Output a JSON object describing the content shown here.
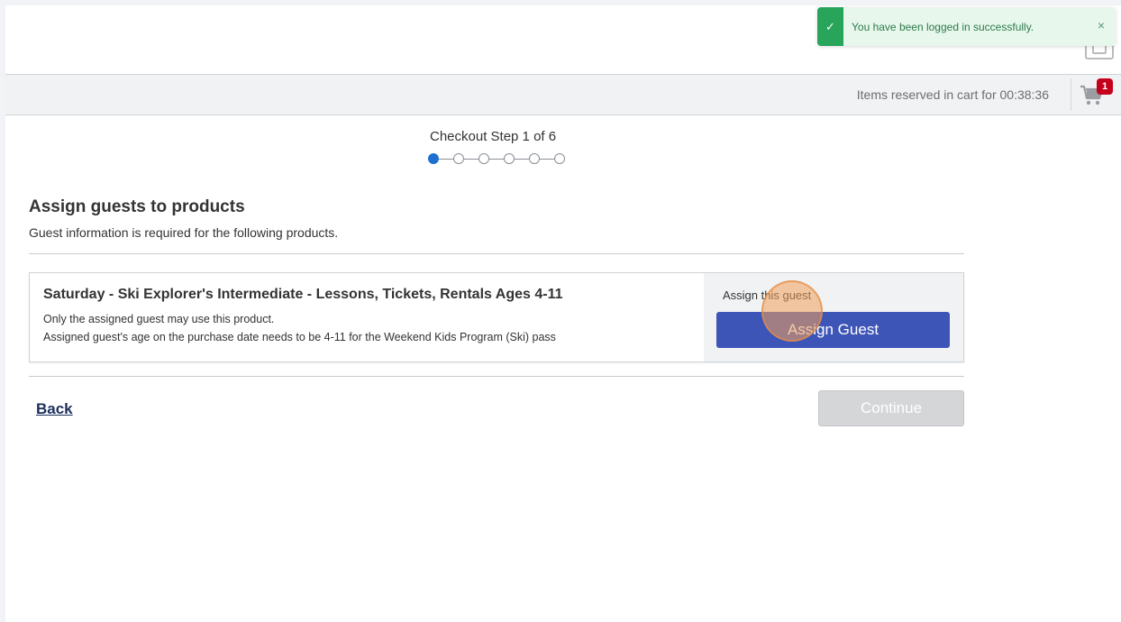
{
  "toast": {
    "message": "You have been logged in successfully.",
    "check_glyph": "✓",
    "close_glyph": "×",
    "accent_color": "#28a55a"
  },
  "cart": {
    "reservation_text": "Items reserved in cart for 00:38:36",
    "count": "1"
  },
  "stepper": {
    "label": "Checkout Step 1 of 6",
    "current_step": 1,
    "total_steps": 6
  },
  "section": {
    "title": "Assign guests to products",
    "subtitle": "Guest information is required for the following products."
  },
  "product": {
    "title": "Saturday - Ski Explorer's Intermediate - Lessons, Tickets, Rentals Ages 4-11",
    "note_1": "Only the assigned guest may use this product.",
    "note_2": "Assigned guest's age on the purchase date needs to be 4-11 for the Weekend Kids Program (Ski) pass",
    "assign_label": "Assign this guest",
    "assign_button": "Assign Guest"
  },
  "nav": {
    "back_label": "Back",
    "continue_label": "Continue"
  },
  "colors": {
    "primary_button": "#3e55b8",
    "active_step": "#1f6fd1",
    "cart_badge": "#c4001c"
  }
}
